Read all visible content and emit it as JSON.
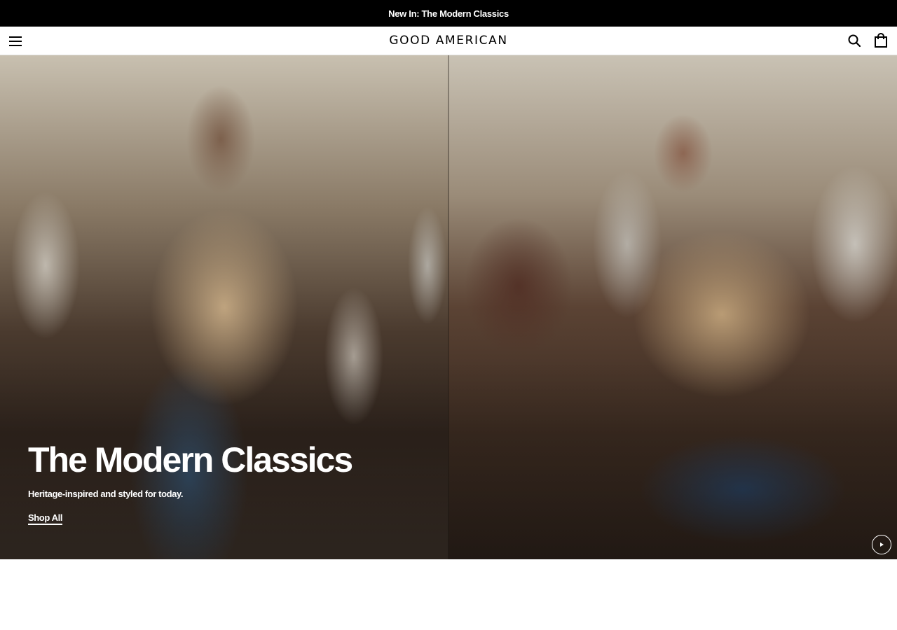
{
  "announcement": {
    "text": "New In: The Modern Classics"
  },
  "header": {
    "logo": "GOOD AMERICAN",
    "menu_icon": "hamburger-menu-icon",
    "search_icon": "search-icon",
    "bag_icon": "shopping-bag-icon"
  },
  "hero": {
    "title": "The Modern Classics",
    "subtitle": "Heritage-inspired and styled for today.",
    "cta_label": "Shop All",
    "play_icon": "play-icon"
  },
  "colors": {
    "announcement_bg": "#000000",
    "header_bg": "#ffffff",
    "text_on_hero": "#ffffff",
    "logo": "#000000"
  }
}
